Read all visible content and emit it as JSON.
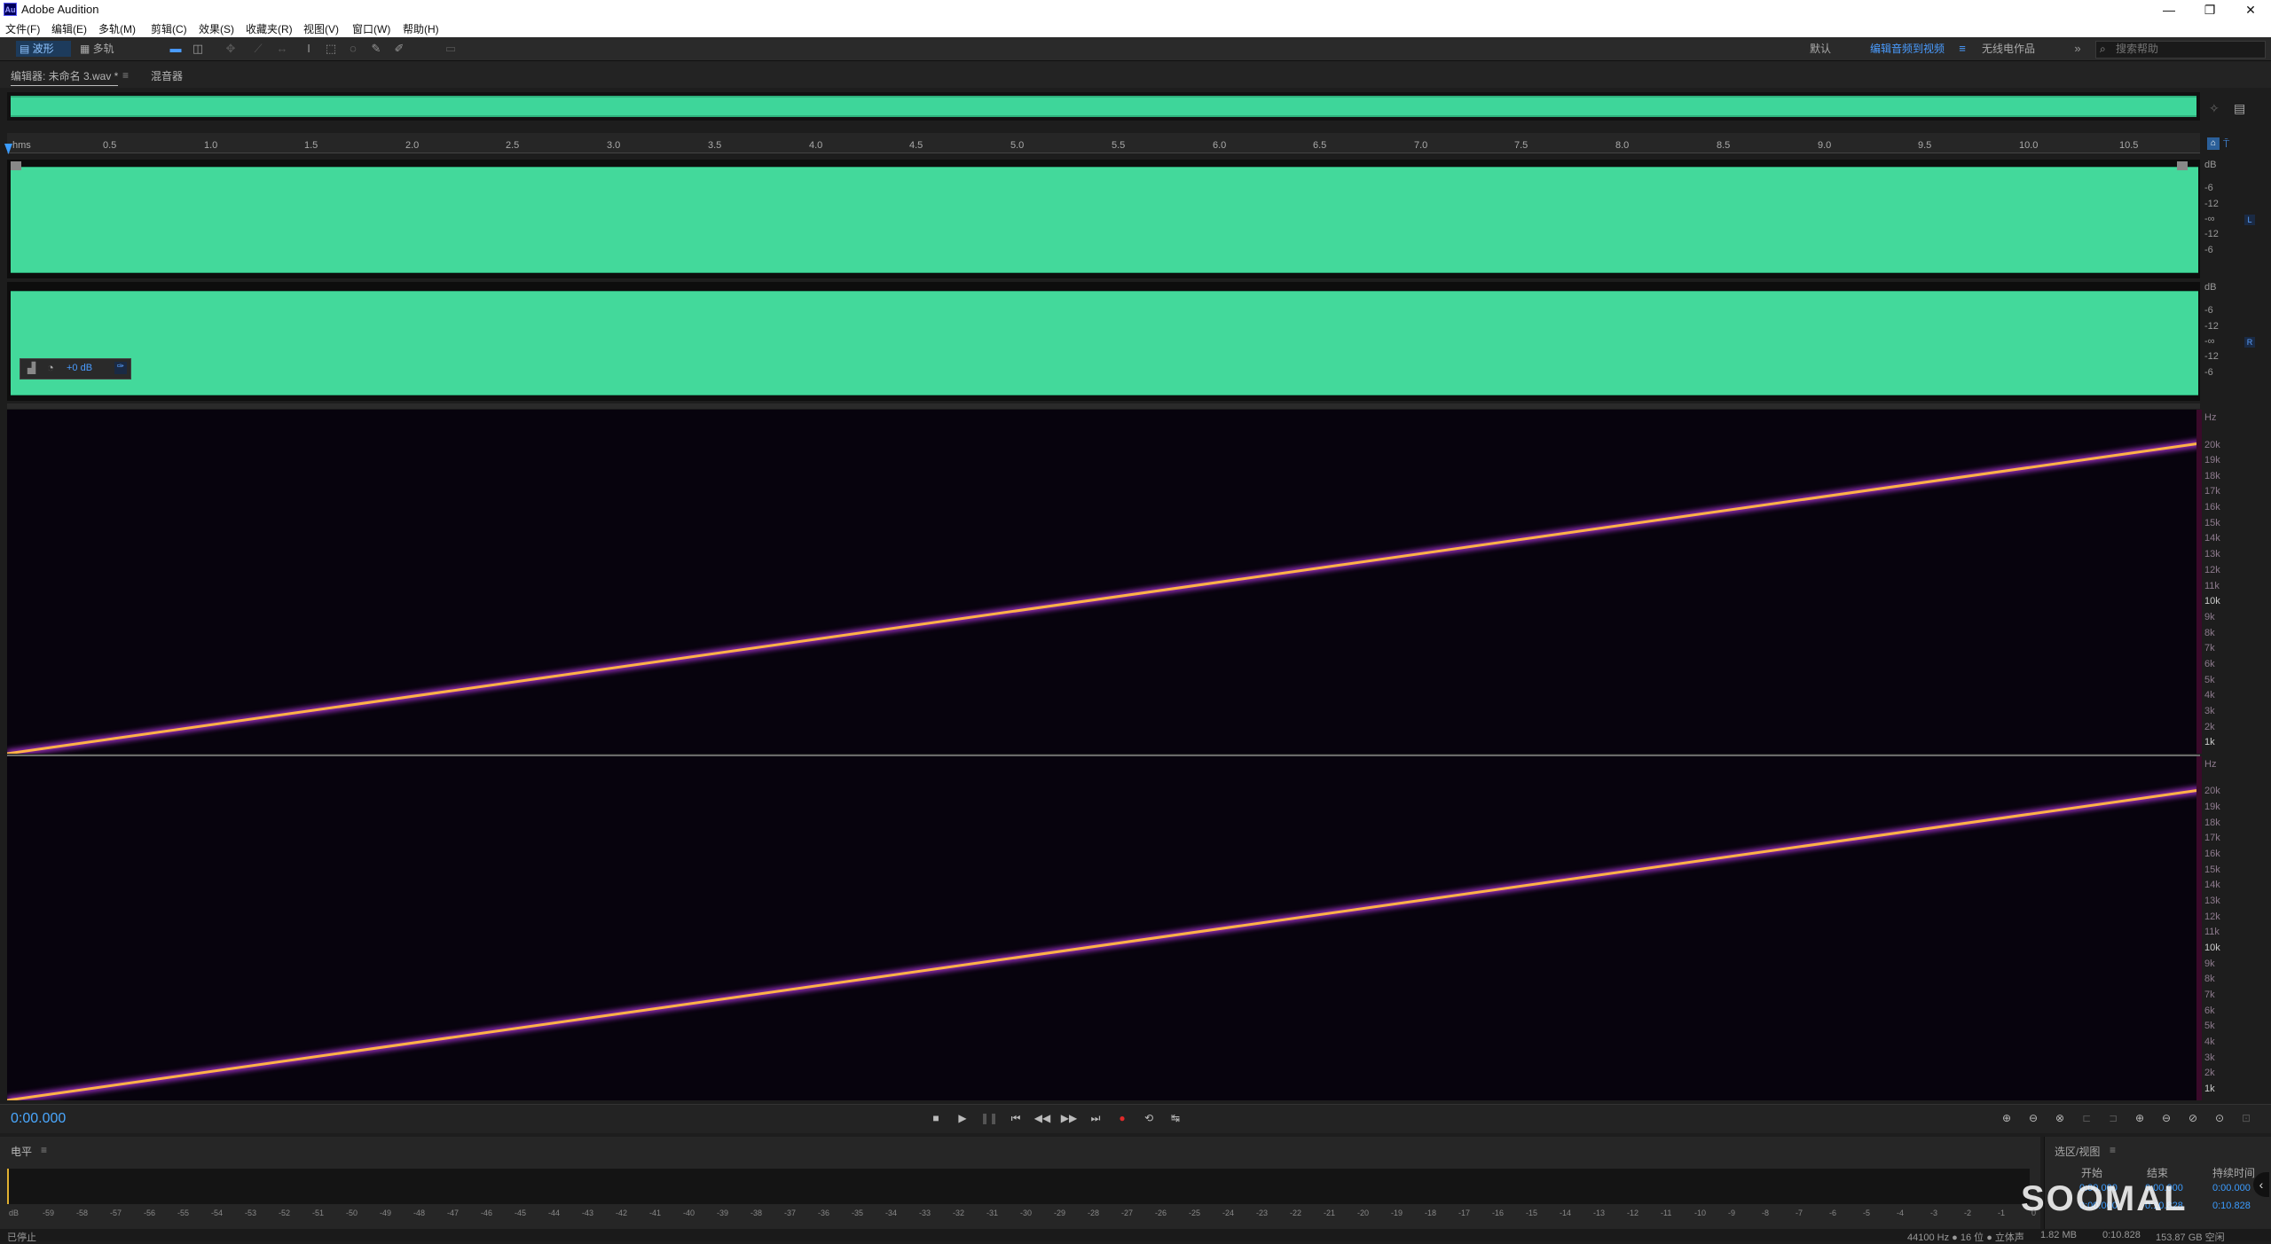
{
  "window": {
    "title": "Adobe Audition",
    "logo": "Au",
    "minimize": "—",
    "restore": "❐",
    "close": "✕"
  },
  "menu": [
    "文件(F)",
    "编辑(E)",
    "多轨(M)",
    "剪辑(C)",
    "效果(S)",
    "收藏夹(R)",
    "视图(V)",
    "窗口(W)",
    "帮助(H)"
  ],
  "toolbar": {
    "waveform_label": "波形",
    "multitrack_label": "多轨",
    "workspaces": [
      "默认",
      "编辑音频到视频",
      "无线电作品"
    ],
    "active_workspace": "编辑音频到视频",
    "more": "»",
    "search_placeholder": "搜索帮助"
  },
  "panels": {
    "editor_tab": "编辑器: 未命名 3.wav *",
    "mixer_tab": "混音器"
  },
  "ruler": {
    "unit": "hms",
    "ticks": [
      "0.5",
      "1.0",
      "1.5",
      "2.0",
      "2.5",
      "3.0",
      "3.5",
      "4.0",
      "4.5",
      "5.0",
      "5.5",
      "6.0",
      "6.5",
      "7.0",
      "7.5",
      "8.0",
      "8.5",
      "9.0",
      "9.5",
      "10.0",
      "10.5"
    ]
  },
  "channels": {
    "left": {
      "label": "L",
      "db_scale": [
        "dB",
        "-6",
        "-12",
        "-∞",
        "-12",
        "-6"
      ]
    },
    "right": {
      "label": "R",
      "db_scale": [
        "dB",
        "-6",
        "-12",
        "-∞",
        "-12",
        "-6"
      ]
    }
  },
  "hud": {
    "volume": "+0 dB"
  },
  "spectrogram": {
    "hz_unit": "Hz",
    "hz_labels": [
      "20k",
      "19k",
      "18k",
      "17k",
      "16k",
      "15k",
      "14k",
      "13k",
      "12k",
      "11k",
      "10k",
      "9k",
      "8k",
      "7k",
      "6k",
      "5k",
      "4k",
      "3k",
      "2k",
      "1k"
    ]
  },
  "transport": {
    "time": "0:00.000"
  },
  "levels": {
    "title": "电平",
    "ticks": [
      "dB",
      "-59",
      "-58",
      "-57",
      "-56",
      "-55",
      "-54",
      "-53",
      "-52",
      "-51",
      "-50",
      "-49",
      "-48",
      "-47",
      "-46",
      "-45",
      "-44",
      "-43",
      "-42",
      "-41",
      "-40",
      "-39",
      "-38",
      "-37",
      "-36",
      "-35",
      "-34",
      "-33",
      "-32",
      "-31",
      "-30",
      "-29",
      "-28",
      "-27",
      "-26",
      "-25",
      "-24",
      "-23",
      "-22",
      "-21",
      "-20",
      "-19",
      "-18",
      "-17",
      "-16",
      "-15",
      "-14",
      "-13",
      "-12",
      "-11",
      "-10",
      "-9",
      "-8",
      "-7",
      "-6",
      "-5",
      "-4",
      "-3",
      "-2",
      "-1",
      "0"
    ]
  },
  "selection": {
    "title": "选区/视图",
    "col_start": "开始",
    "col_end": "结束",
    "col_duration": "持续时间",
    "row1_start": "0:00.000",
    "row1_end": "0:00.000",
    "row1_duration": "0:00.000",
    "row2_start": "0:00.000",
    "row2_end": "0:10.828",
    "row2_duration": "0:10.828"
  },
  "status": {
    "state": "已停止",
    "format": "44100 Hz ● 16 位 ● 立体声",
    "size": "1.82 MB",
    "duration": "0:10.828",
    "free": "153.87 GB 空闲"
  },
  "watermark": "SOOMAL",
  "colors": {
    "waveform": "#43d99b",
    "accent": "#3b9cff",
    "sweep": "#ffb347"
  }
}
